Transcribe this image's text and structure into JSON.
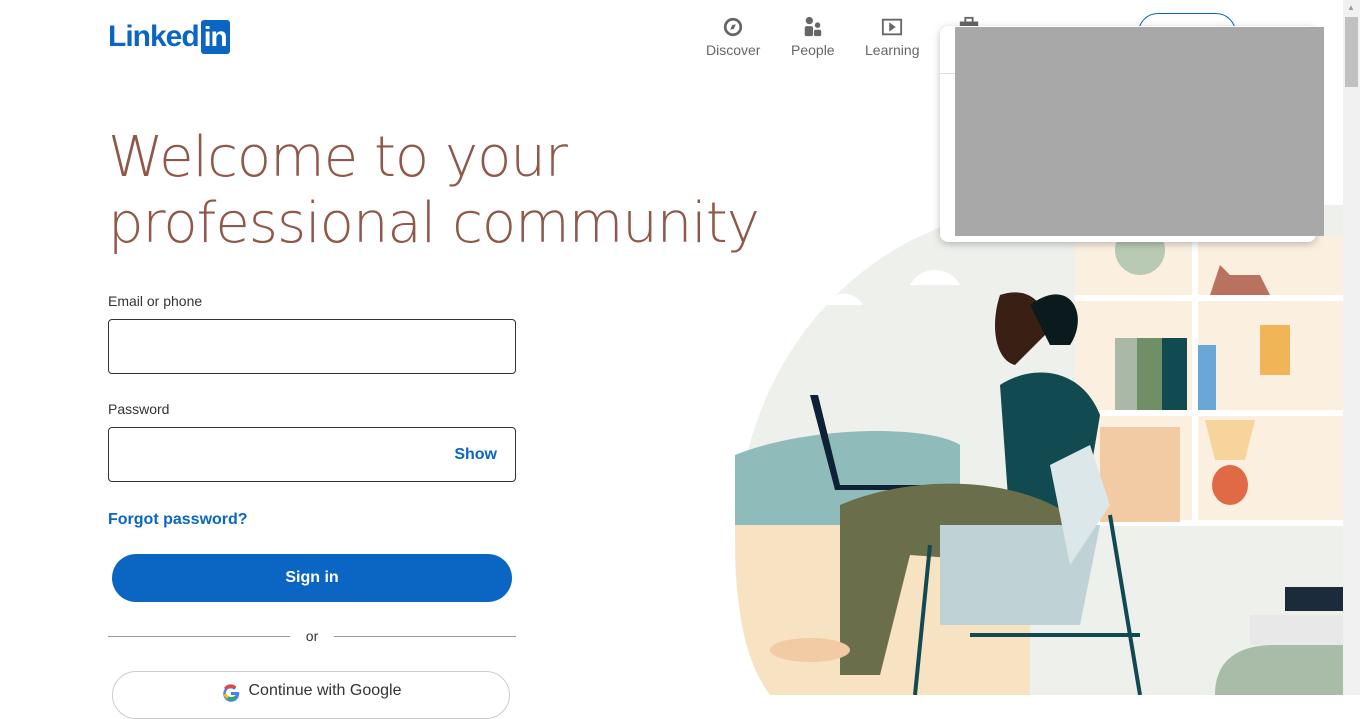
{
  "logo": {
    "text": "Linked",
    "in": "in"
  },
  "nav": [
    {
      "label": "Discover",
      "icon": "compass-icon"
    },
    {
      "label": "People",
      "icon": "people-icon"
    },
    {
      "label": "Learning",
      "icon": "video-play-icon"
    },
    {
      "label": "",
      "icon": "briefcase-icon"
    }
  ],
  "headline": {
    "line1": "Welcome to your",
    "line2": "professional community"
  },
  "form": {
    "email_label": "Email or phone",
    "email_value": "",
    "password_label": "Password",
    "password_value": "",
    "show": "Show",
    "forgot": "Forgot password?",
    "signin": "Sign in",
    "or": "or",
    "google": "Continue with Google"
  },
  "colors": {
    "brand": "#0a66c2",
    "headline": "#8f5849"
  }
}
